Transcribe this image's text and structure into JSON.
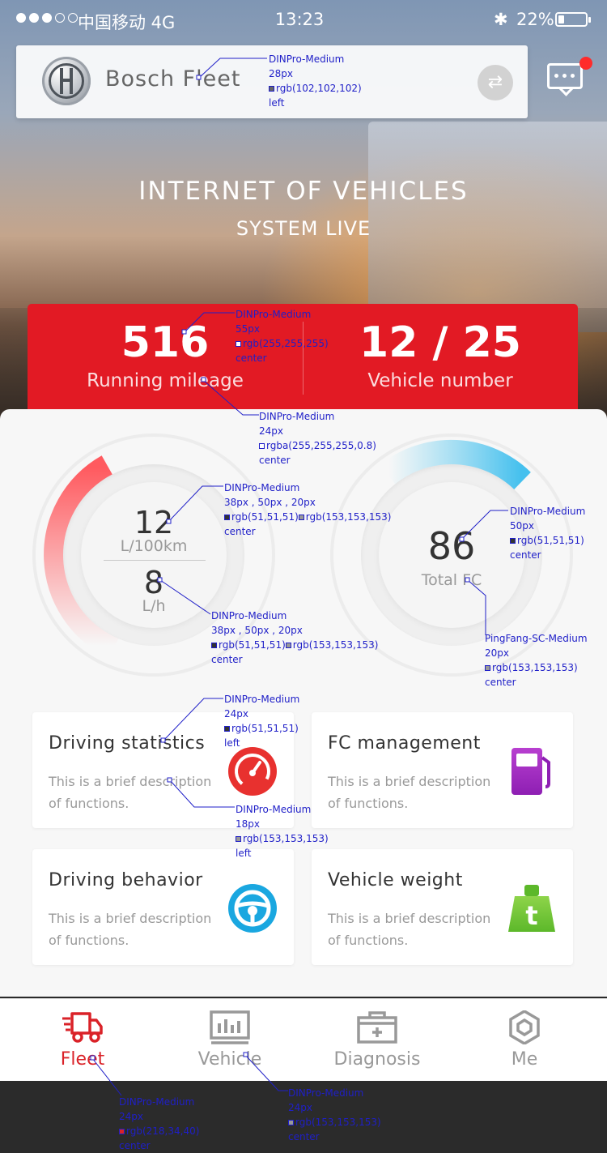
{
  "status_bar": {
    "carrier": "中国移动 4G",
    "time": "13:23",
    "battery_text": "22%",
    "battery_level": 0.22
  },
  "header": {
    "brand_name": "Bosch Fleet",
    "switch_icon": "swap-arrows-icon",
    "message_icon": "chat-bubble-icon"
  },
  "hero": {
    "title": "INTERNET OF VEHICLES",
    "subtitle": "SYSTEM LIVE"
  },
  "stats": {
    "mileage_value": "516",
    "mileage_label": "Running mileage",
    "vehicle_value": "12 / 25",
    "vehicle_label": "Vehicle number"
  },
  "gauges": {
    "consumption": {
      "per100_value": "12",
      "per100_unit": "L/100km",
      "per_hour_value": "8",
      "per_hour_unit": "L/h"
    },
    "total_fc": {
      "value": "86",
      "label": "Total FC"
    }
  },
  "cards": [
    {
      "title": "Driving statistics",
      "desc_line1": "This is a brief description",
      "desc_line2": "of functions.",
      "icon": "speedometer-icon"
    },
    {
      "title": "FC management",
      "desc_line1": "This is a brief description",
      "desc_line2": "of functions.",
      "icon": "fuel-pump-icon"
    },
    {
      "title": "Driving behavior",
      "desc_line1": "This is a brief description",
      "desc_line2": "of functions.",
      "icon": "steering-wheel-icon"
    },
    {
      "title": "Vehicle weight",
      "desc_line1": "This is a brief description",
      "desc_line2": "of functions.",
      "icon": "weight-icon"
    }
  ],
  "nav": [
    {
      "label": "Fleet",
      "icon": "truck-icon",
      "active": true
    },
    {
      "label": "Vehicle",
      "icon": "monitor-chart-icon",
      "active": false
    },
    {
      "label": "Diagnosis",
      "icon": "toolbox-icon",
      "active": false
    },
    {
      "label": "Me",
      "icon": "hexagon-user-icon",
      "active": false
    }
  ],
  "colors": {
    "brand_red": "#e21a24",
    "active_tab": "rgb(218,34,40)",
    "inactive_tab": "rgb(153,153,153)",
    "text_dark": "rgb(51,51,51)",
    "text_gray": "rgb(153,153,153)"
  },
  "annotations": {
    "brand": {
      "font": "DINPro-Medium",
      "size": "28px",
      "color": "rgb(102,102,102)",
      "align": "left"
    },
    "stat_value": {
      "font": "DINPro-Medium",
      "size": "55px",
      "color": "rgb(255,255,255)",
      "align": "center"
    },
    "stat_label": {
      "font": "DINPro-Medium",
      "size": "24px",
      "color": "rgba(255,255,255,0.8)",
      "align": "center"
    },
    "gauge1_top": {
      "font": "DINPro-Medium",
      "size": "38px , 50px , 20px",
      "color1": "rgb(51,51,51)",
      "color2": "rgb(153,153,153)",
      "align": "center"
    },
    "gauge2_value": {
      "font": "DINPro-Medium",
      "size": "50px",
      "color": "rgb(51,51,51)",
      "align": "center"
    },
    "gauge1_bottom": {
      "font": "DINPro-Medium",
      "size": "38px , 50px , 20px",
      "color1": "rgb(51,51,51)",
      "color2": "rgb(153,153,153)",
      "align": "center"
    },
    "gauge2_label": {
      "font": "PingFang-SC-Medium",
      "size": "20px",
      "color": "rgb(153,153,153)",
      "align": "center"
    },
    "card_title": {
      "font": "DINPro-Medium",
      "size": "24px",
      "color": "rgb(51,51,51)",
      "align": "left"
    },
    "card_desc": {
      "font": "DINPro-Medium",
      "size": "18px",
      "color": "rgb(153,153,153)",
      "align": "left"
    },
    "tab_active": {
      "font": "DINPro-Medium",
      "size": "24px",
      "color": "rgb(218,34,40)",
      "align": "center"
    },
    "tab_inactive": {
      "font": "DINPro-Medium",
      "size": "24px",
      "color": "rgb(153,153,153)",
      "align": "center"
    }
  }
}
